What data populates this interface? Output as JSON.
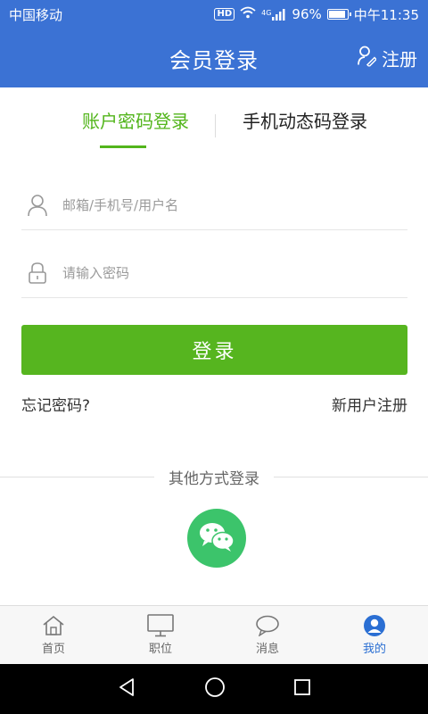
{
  "status_bar": {
    "carrier": "中国移动",
    "hd": "HD",
    "network": "4G",
    "battery_percent": "96%",
    "battery_level": 0.96,
    "time": "中午11:35"
  },
  "header": {
    "title": "会员登录",
    "register_label": "注册",
    "background_color": "#3b72d4"
  },
  "tabs": [
    {
      "label": "账户密码登录",
      "active": true
    },
    {
      "label": "手机动态码登录",
      "active": false
    }
  ],
  "form": {
    "username": {
      "placeholder": "邮箱/手机号/用户名",
      "value": "",
      "icon": "user-icon"
    },
    "password": {
      "placeholder": "请输入密码",
      "value": "",
      "icon": "lock-icon"
    },
    "login_label": "登录",
    "forgot_label": "忘记密码?",
    "new_user_label": "新用户注册",
    "accent_color": "#56b51f"
  },
  "other_login": {
    "label": "其他方式登录",
    "wechat_icon": "wechat-icon"
  },
  "tabbar": {
    "items": [
      {
        "label": "首页",
        "icon": "home-icon",
        "active": false
      },
      {
        "label": "职位",
        "icon": "monitor-icon",
        "active": false
      },
      {
        "label": "消息",
        "icon": "message-icon",
        "active": false
      },
      {
        "label": "我的",
        "icon": "profile-icon",
        "active": true
      }
    ],
    "active_color": "#2b6fd3"
  },
  "system_nav": {
    "buttons": [
      "back-icon",
      "home-circle-icon",
      "recents-icon"
    ]
  }
}
